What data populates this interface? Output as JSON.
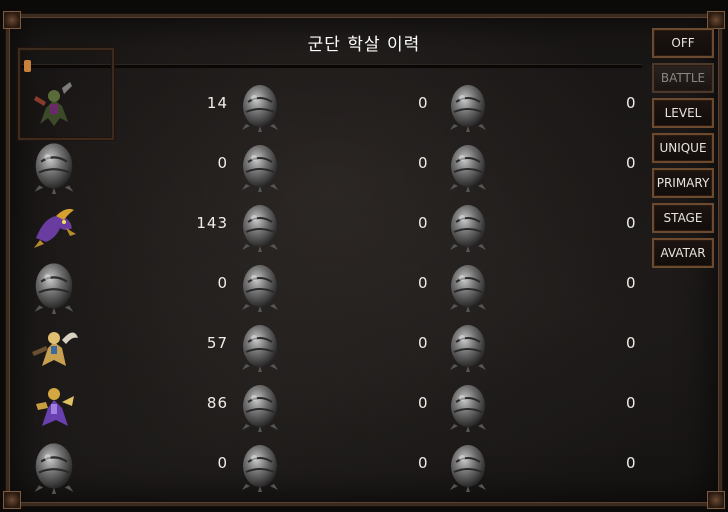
{
  "title": "군단 학살 이력",
  "tabs": [
    {
      "label": "OFF",
      "active": false
    },
    {
      "label": "BATTLE",
      "active": true
    },
    {
      "label": "LEVEL",
      "active": false
    },
    {
      "label": "UNIQUE",
      "active": false
    },
    {
      "label": "PRIMARY",
      "active": false
    },
    {
      "label": "STAGE",
      "active": false
    },
    {
      "label": "AVATAR",
      "active": false
    }
  ],
  "rows": [
    {
      "unit": "hero-warrior-icon",
      "col1": "14",
      "col2": "0",
      "col3": "0"
    },
    {
      "unit": "egg-icon",
      "col1": "0",
      "col2": "0",
      "col3": "0"
    },
    {
      "unit": "purple-creature-icon",
      "col1": "143",
      "col2": "0",
      "col3": "0"
    },
    {
      "unit": "egg-icon",
      "col1": "0",
      "col2": "0",
      "col3": "0"
    },
    {
      "unit": "gold-knight-icon",
      "col1": "57",
      "col2": "0",
      "col3": "0"
    },
    {
      "unit": "purple-knight-icon",
      "col1": "86",
      "col2": "0",
      "col3": "0"
    },
    {
      "unit": "egg-icon",
      "col1": "0",
      "col2": "0",
      "col3": "0"
    }
  ],
  "colors": {
    "border": "#6b4a30",
    "accent": "#c9823c",
    "text": "#f1ede8"
  }
}
